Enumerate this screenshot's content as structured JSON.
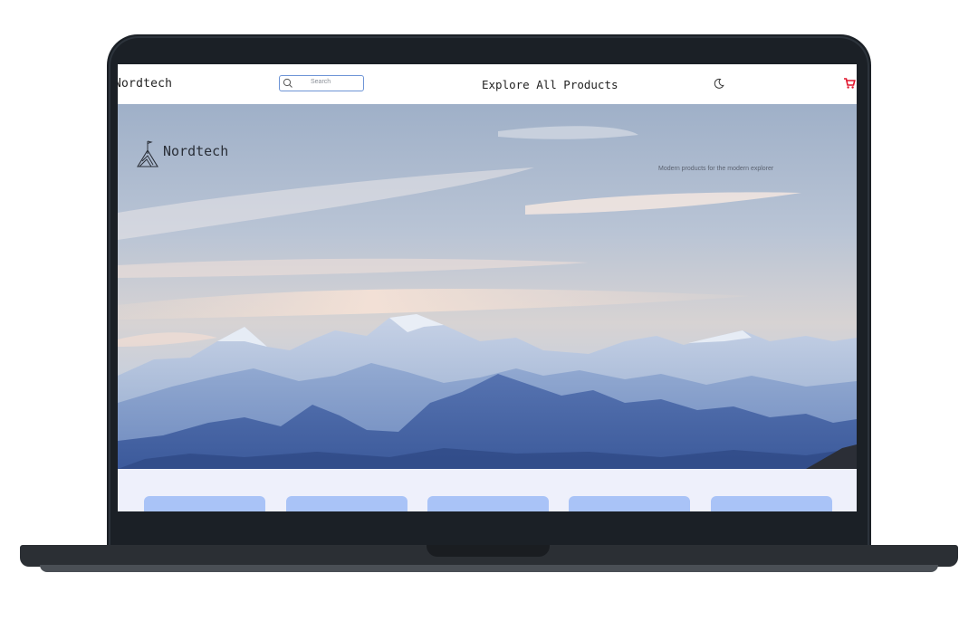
{
  "nav": {
    "brand": "Nordtech",
    "search_placeholder": "Search",
    "title": "Explore All Products",
    "icons": [
      "search-icon",
      "moon-icon",
      "cart-icon"
    ]
  },
  "hero": {
    "logo_text": "Nordtech",
    "tagline": "Modern products for the modern explorer"
  },
  "colors": {
    "accent": "#a9c3f7",
    "search_border": "#6d94d6",
    "cart": "#e0142b",
    "frame": "#1b2026"
  },
  "cards": [
    {
      "id": "product-card-1"
    },
    {
      "id": "product-card-2"
    },
    {
      "id": "product-card-3"
    },
    {
      "id": "product-card-4"
    },
    {
      "id": "product-card-5"
    }
  ]
}
